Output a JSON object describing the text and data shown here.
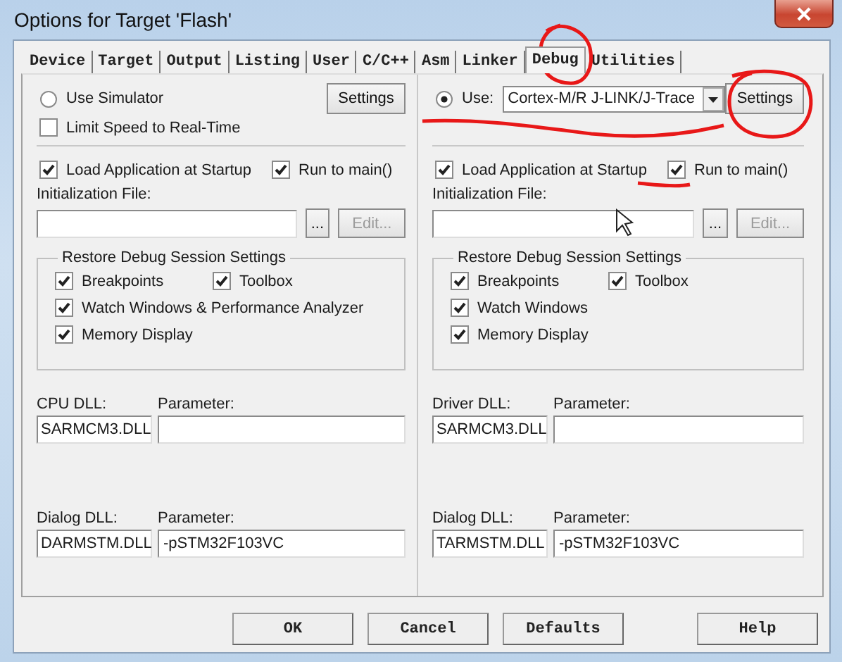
{
  "window": {
    "title": "Options for Target 'Flash'"
  },
  "tabs": [
    {
      "label": "Device",
      "selected": false
    },
    {
      "label": "Target",
      "selected": false
    },
    {
      "label": "Output",
      "selected": false
    },
    {
      "label": "Listing",
      "selected": false
    },
    {
      "label": "User",
      "selected": false
    },
    {
      "label": "C/C++",
      "selected": false
    },
    {
      "label": "Asm",
      "selected": false
    },
    {
      "label": "Linker",
      "selected": false
    },
    {
      "label": "Debug",
      "selected": true
    },
    {
      "label": "Utilities",
      "selected": false
    }
  ],
  "panels": [
    {
      "use": {
        "label": "Use Simulator",
        "selected": false
      },
      "limit_speed": {
        "label": "Limit Speed to Real-Time",
        "checked": false
      },
      "settings_button": "Settings",
      "load_application": {
        "label": "Load Application at Startup",
        "checked": true
      },
      "run_to_main": {
        "label": "Run to main()",
        "checked": true
      },
      "init_file_label": "Initialization File:",
      "browse_button": "...",
      "edit_button": {
        "label": "Edit...",
        "disabled": true
      },
      "restore_group": {
        "title": "Restore Debug Session Settings",
        "options": [
          {
            "label": "Breakpoints",
            "checked": true
          },
          {
            "label": "Toolbox",
            "checked": true
          },
          {
            "label": "Watch Windows & Performance Analyzer",
            "checked": true
          },
          {
            "label": "Memory Display",
            "checked": true
          }
        ]
      },
      "dll_label": "CPU DLL:",
      "dll_value": "SARMCM3.DLL",
      "dll_param_label": "Parameter:",
      "dialog_dll_label": "Dialog DLL:",
      "dialog_dll_value": "DARMSTM.DLL",
      "dialog_param_label": "Parameter:",
      "dialog_param_value": "-pSTM32F103VC"
    },
    {
      "use": {
        "label": "Use:",
        "selected": true
      },
      "driver": "Cortex-M/R J-LINK/J-Trace",
      "settings_button": "Settings",
      "load_application": {
        "label": "Load Application at Startup",
        "checked": true
      },
      "run_to_main": {
        "label": "Run to main()",
        "checked": true
      },
      "init_file_label": "Initialization File:",
      "browse_button": "...",
      "edit_button": {
        "label": "Edit...",
        "disabled": true
      },
      "restore_group": {
        "title": "Restore Debug Session Settings",
        "options": [
          {
            "label": "Breakpoints",
            "checked": true
          },
          {
            "label": "Toolbox",
            "checked": true
          },
          {
            "label": "Watch Windows",
            "checked": true
          },
          {
            "label": "Memory Display",
            "checked": true
          }
        ]
      },
      "dll_label": "Driver DLL:",
      "dll_value": "SARMCM3.DLL",
      "dll_param_label": "Parameter:",
      "dialog_dll_label": "Dialog DLL:",
      "dialog_dll_value": "TARMSTM.DLL",
      "dialog_param_label": "Parameter:",
      "dialog_param_value": "-pSTM32F103VC"
    }
  ],
  "buttons": [
    "OK",
    "Cancel",
    "Defaults",
    "Help"
  ]
}
